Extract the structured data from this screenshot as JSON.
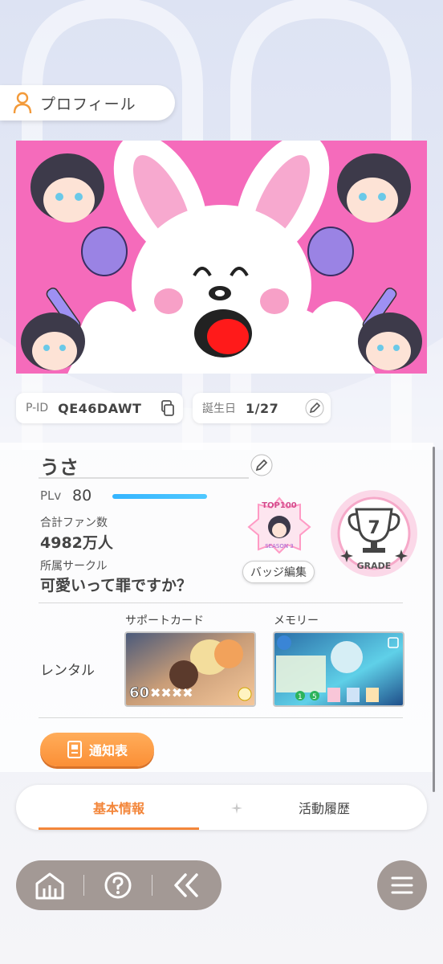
{
  "header": {
    "title": "プロフィール",
    "icon": "person-icon"
  },
  "profile": {
    "pid_label": "P-ID",
    "pid_value": "QE46DAWT",
    "birthday_label": "誕生日",
    "birthday_value": "1/27",
    "name": "うさ",
    "plv_label": "PLv",
    "plv_value": "80",
    "fans_label": "合計ファン数",
    "fans_value": "4982万人",
    "circle_label": "所属サークル",
    "circle_value": "可愛いって罪ですか？"
  },
  "badge": {
    "line1": "TOP100",
    "line2": "SEASON 3",
    "edit_label": "バッジ編集"
  },
  "grade": {
    "value": "7",
    "label": "GRADE"
  },
  "rental": {
    "label": "レンタル",
    "support_label": "サポートカード",
    "support_level": "60",
    "memory_label": "メモリー",
    "memory_values": [
      "1",
      "5"
    ]
  },
  "report_button": {
    "label": "通知表"
  },
  "tabs": [
    {
      "label": "基本情報",
      "active": true
    },
    {
      "label": "活動履歴",
      "active": false
    }
  ],
  "nav": {
    "icons": [
      "home-icon",
      "help-icon",
      "back-icon",
      "menu-icon"
    ]
  },
  "colors": {
    "accent_orange": "#f3863a",
    "banner_pink": "#f56bbb",
    "plv_bar": "#35b5ff",
    "nav_gray": "#a39995"
  }
}
